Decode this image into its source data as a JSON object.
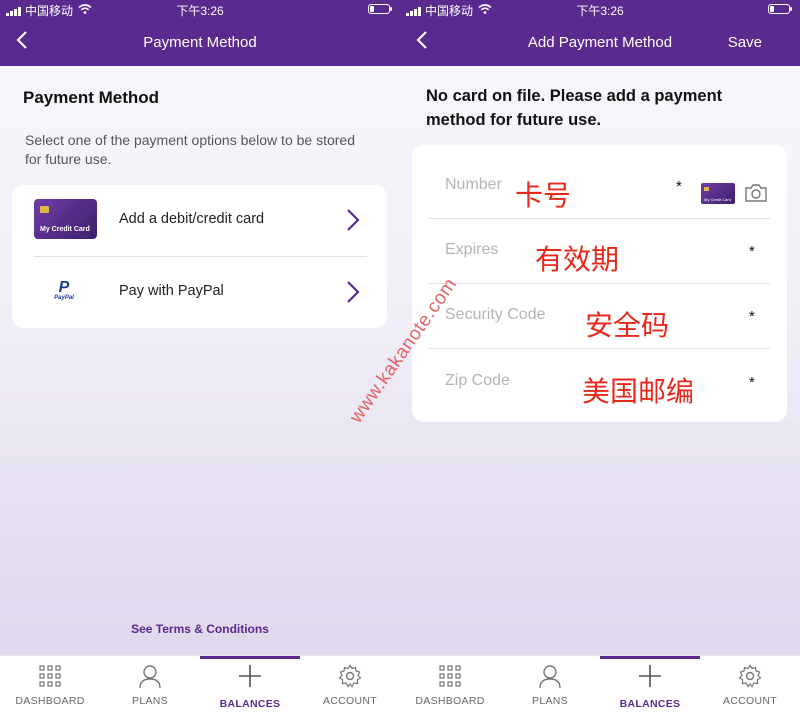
{
  "status_bar": {
    "carrier": "中国移动",
    "time": "下午3:26"
  },
  "left_screen": {
    "nav": {
      "title": "Payment Method",
      "back_icon": "chevron-left-icon"
    },
    "heading": "Payment Method",
    "description": "Select one of the payment options below to be stored for future use.",
    "options": [
      {
        "label": "Add a debit/credit card",
        "icon": "credit-card-icon",
        "card_text": "My Credit Card"
      },
      {
        "label": "Pay with PayPal",
        "icon": "paypal-icon",
        "icon_text": "PayPal"
      }
    ],
    "terms_link": "See Terms & Conditions"
  },
  "right_screen": {
    "nav": {
      "title": "Add Payment Method",
      "save_label": "Save",
      "back_icon": "chevron-left-icon"
    },
    "heading": "No card on file. Please add a payment method for future use.",
    "fields": [
      {
        "placeholder": "Number",
        "annotation": "卡号",
        "required_mark": "*",
        "mini_card_text": "My Credit Card",
        "camera_icon": "camera-icon"
      },
      {
        "placeholder": "Expires",
        "annotation": "有效期",
        "required_mark": "*"
      },
      {
        "placeholder": "Security Code",
        "annotation": "安全码",
        "required_mark": "*"
      },
      {
        "placeholder": "Zip Code",
        "annotation": "美国邮编",
        "required_mark": "*"
      }
    ]
  },
  "tab_bar": {
    "tabs": [
      {
        "label": "DASHBOARD",
        "icon": "grid-dots-icon"
      },
      {
        "label": "PLANS",
        "icon": "person-icon"
      },
      {
        "label": "BALANCES",
        "icon": "plus-icon",
        "active": true
      },
      {
        "label": "ACCOUNT",
        "icon": "gear-icon"
      }
    ]
  },
  "watermark": "www.kakanote.com",
  "colors": {
    "brand_purple": "#5b2a8e",
    "annotation_red": "#e8281b"
  }
}
